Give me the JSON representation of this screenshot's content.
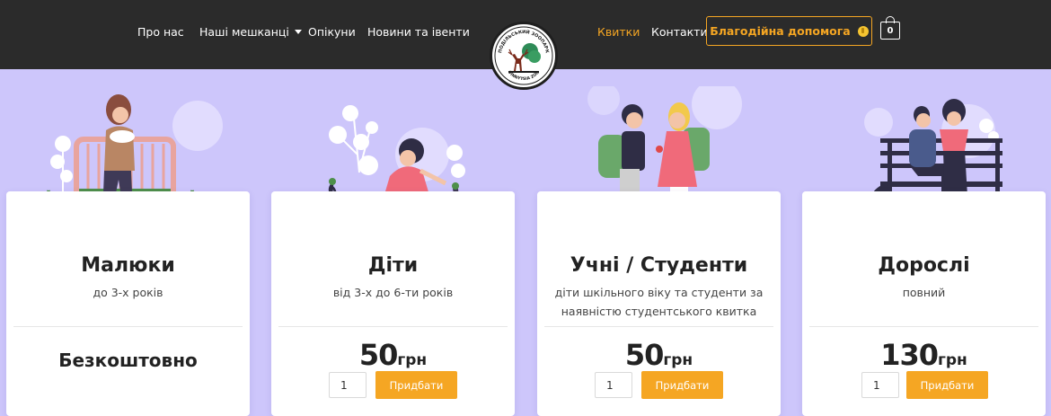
{
  "header": {
    "nav_left": [
      "Про нас",
      "Наші мешканці",
      "Опікуни",
      "Новини та івенти"
    ],
    "nav_right": [
      "Квитки",
      "Контакти"
    ],
    "donate_label": "Благодійна допомога",
    "cart_count": "0",
    "logo_text_top": "ПОДІЛЬСЬКИЙ ЗООПАРК",
    "logo_text_bottom": "VINNYTSIA ZOO"
  },
  "cards": [
    {
      "title": "Малюки",
      "subtitle": "до 3-х років",
      "free_label": "Безкоштовно"
    },
    {
      "title": "Діти",
      "subtitle": "від 3-х до 6-ти років",
      "price": "50",
      "currency": "грн",
      "qty": "1",
      "buy_label": "Придбати"
    },
    {
      "title": "Учні / Студенти",
      "subtitle_line1": "діти шкільного віку та студенти за",
      "subtitle_line2": "наявністю студентського квитка",
      "price": "50",
      "currency": "грн",
      "qty": "1",
      "buy_label": "Придбати"
    },
    {
      "title": "Дорослі",
      "subtitle": "повний",
      "price": "130",
      "currency": "грн",
      "qty": "1",
      "buy_label": "Придбати"
    }
  ],
  "colors": {
    "header_bg": "#2b2b2b",
    "page_bg": "#cdc6fb",
    "accent": "#f5a623",
    "card_bg": "#ffffff"
  }
}
